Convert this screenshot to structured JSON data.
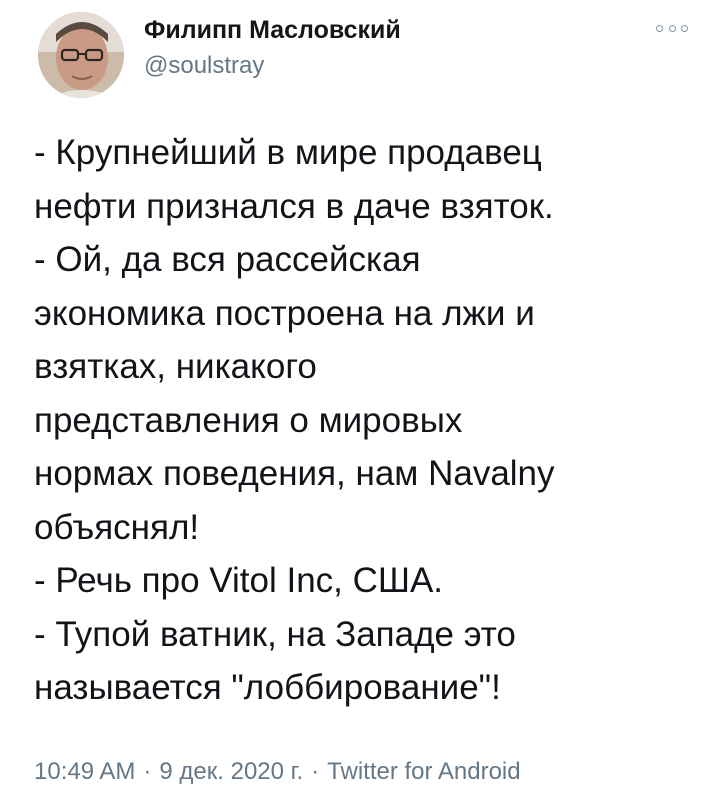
{
  "author": {
    "display_name": "Филипп Масловский",
    "handle": "@soulstray",
    "avatar_icon": "profile-photo"
  },
  "menu": {
    "icon": "more-options-icon"
  },
  "tweet": {
    "lines": [
      "- Крупнейший в мире продавец",
      "нефти признался в даче взяток.",
      "- Ой, да вся рассейская",
      "экономика построена на лжи и",
      "взятках, никакого",
      "представления о мировых",
      "нормах поведения, нам Navalny",
      "объяснял!",
      "- Речь про Vitol Inc, США.",
      "- Тупой ватник, на Западе это",
      "называется \"лоббирование\"!"
    ]
  },
  "meta": {
    "time": "10:49 AM",
    "separator": "·",
    "date": "9 дек. 2020 г.",
    "source": "Twitter for Android"
  },
  "colors": {
    "text": "#14171a",
    "secondary": "#657786"
  }
}
